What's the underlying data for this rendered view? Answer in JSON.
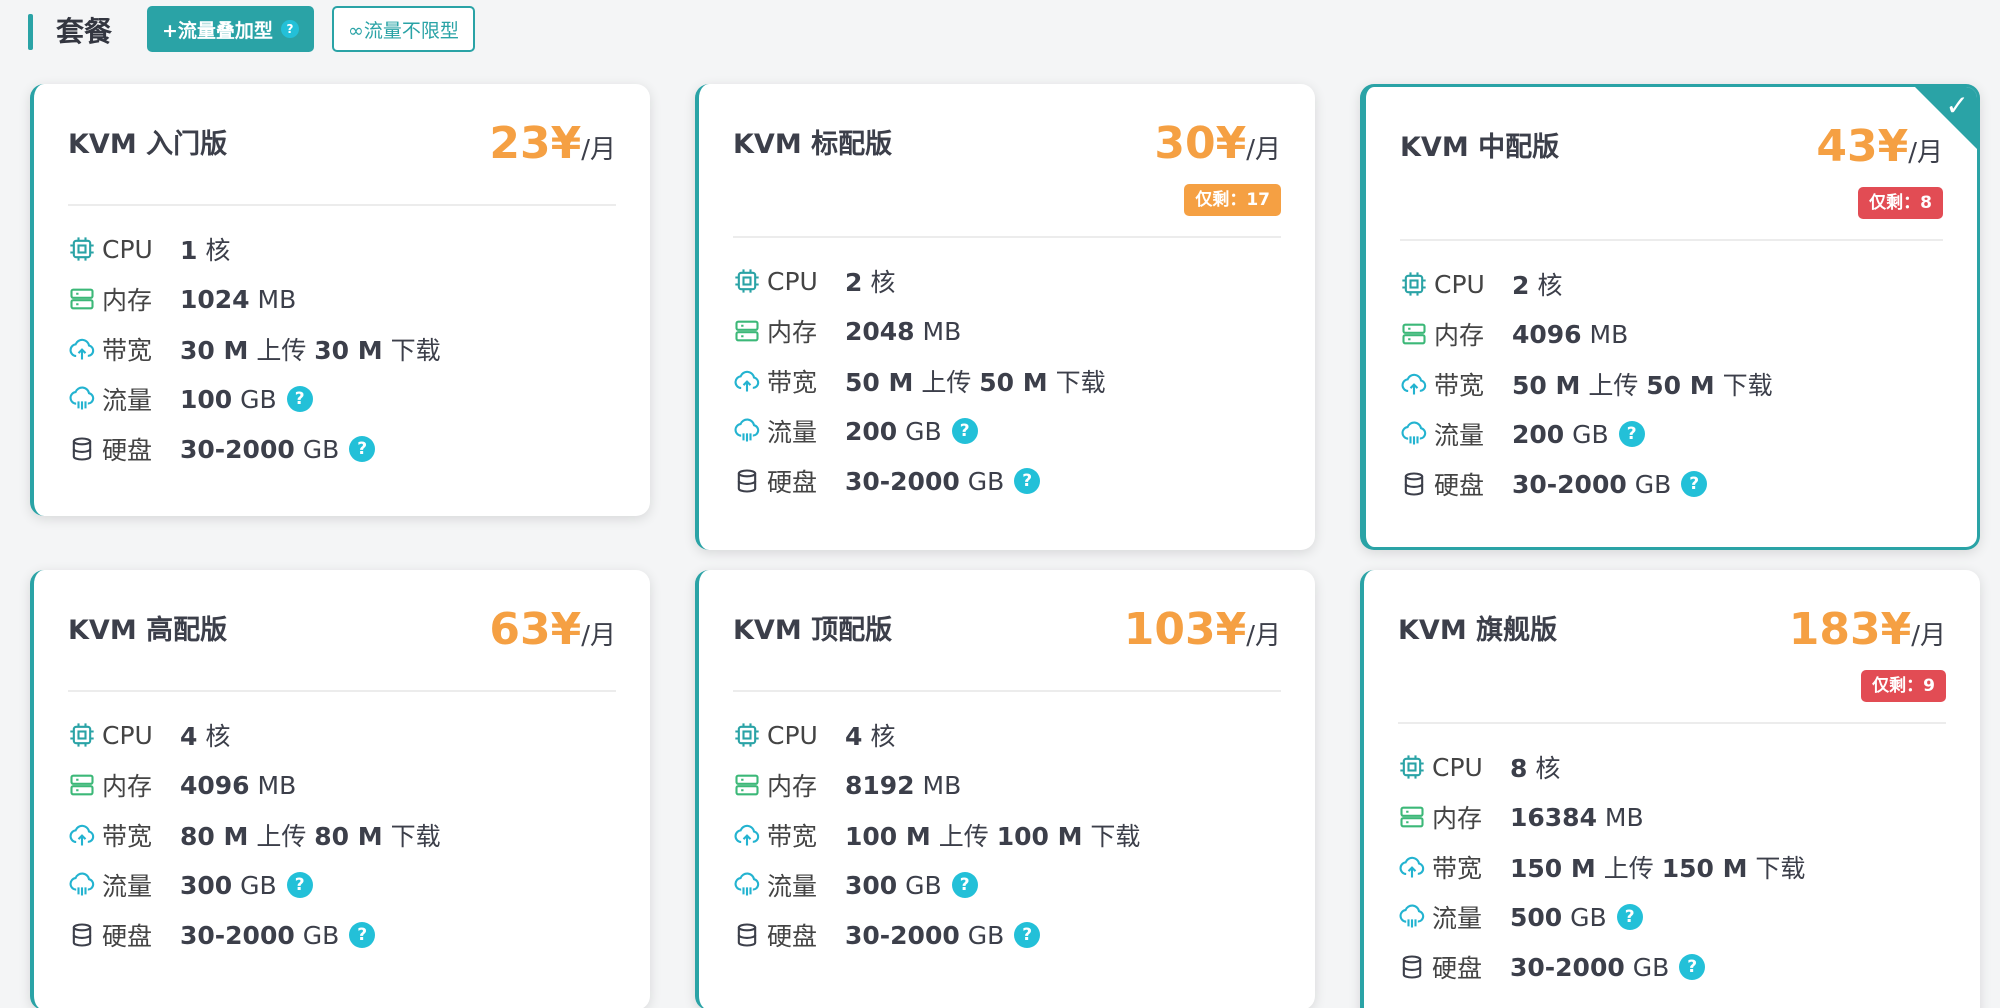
{
  "header": {
    "title": "套餐",
    "btn_traffic_addon": "+流量叠加型",
    "btn_unlimited": "∞流量不限型"
  },
  "labels": {
    "cpu": "CPU",
    "memory": "内存",
    "bandwidth": "带宽",
    "traffic": "流量",
    "disk": "硬盘",
    "price_unit": "/月",
    "help": "?",
    "selected_check": "✓"
  },
  "icons": {
    "cpu": "cpu-icon",
    "memory": "memory-icon",
    "bandwidth": "upload-cloud-icon",
    "traffic": "cloud-rain-icon",
    "disk": "database-icon"
  },
  "colors": {
    "accent": "#2aa3a6",
    "price": "#f5a043",
    "stock_orange": "#f5a043",
    "stock_red": "#e24c54",
    "help": "#23c0d8"
  },
  "plans": [
    {
      "name": "KVM 入门版",
      "price": "23¥",
      "stock": "",
      "cpu_num": "1",
      "cpu_unit": " 核",
      "mem_num": "1024",
      "mem_unit": " MB",
      "bw_up": "30 M",
      "bw_up_text": " 上传 ",
      "bw_down": "30 M",
      "bw_down_text": " 下载",
      "traffic_num": "100",
      "traffic_unit": " GB",
      "disk_num": "30-2000",
      "disk_unit": " GB"
    },
    {
      "name": "KVM 标配版",
      "price": "30¥",
      "stock": "仅剩：17",
      "cpu_num": "2",
      "cpu_unit": " 核",
      "mem_num": "2048",
      "mem_unit": " MB",
      "bw_up": "50 M",
      "bw_up_text": " 上传 ",
      "bw_down": "50 M",
      "bw_down_text": " 下载",
      "traffic_num": "200",
      "traffic_unit": " GB",
      "disk_num": "30-2000",
      "disk_unit": " GB"
    },
    {
      "name": "KVM 中配版",
      "price": "43¥",
      "stock": "仅剩：8",
      "cpu_num": "2",
      "cpu_unit": " 核",
      "mem_num": "4096",
      "mem_unit": " MB",
      "bw_up": "50 M",
      "bw_up_text": " 上传 ",
      "bw_down": "50 M",
      "bw_down_text": " 下载",
      "traffic_num": "200",
      "traffic_unit": " GB",
      "disk_num": "30-2000",
      "disk_unit": " GB"
    },
    {
      "name": "KVM 高配版",
      "price": "63¥",
      "stock": "",
      "cpu_num": "4",
      "cpu_unit": " 核",
      "mem_num": "4096",
      "mem_unit": " MB",
      "bw_up": "80 M",
      "bw_up_text": " 上传 ",
      "bw_down": "80 M",
      "bw_down_text": " 下载",
      "traffic_num": "300",
      "traffic_unit": " GB",
      "disk_num": "30-2000",
      "disk_unit": " GB"
    },
    {
      "name": "KVM 顶配版",
      "price": "103¥",
      "stock": "",
      "cpu_num": "4",
      "cpu_unit": " 核",
      "mem_num": "8192",
      "mem_unit": " MB",
      "bw_up": "100 M",
      "bw_up_text": " 上传 ",
      "bw_down": "100 M",
      "bw_down_text": " 下载",
      "traffic_num": "300",
      "traffic_unit": " GB",
      "disk_num": "30-2000",
      "disk_unit": " GB"
    },
    {
      "name": "KVM 旗舰版",
      "price": "183¥",
      "stock": "仅剩：9",
      "cpu_num": "8",
      "cpu_unit": " 核",
      "mem_num": "16384",
      "mem_unit": " MB",
      "bw_up": "150 M",
      "bw_up_text": " 上传 ",
      "bw_down": "150 M",
      "bw_down_text": " 下载",
      "traffic_num": "500",
      "traffic_unit": " GB",
      "disk_num": "30-2000",
      "disk_unit": " GB"
    }
  ]
}
